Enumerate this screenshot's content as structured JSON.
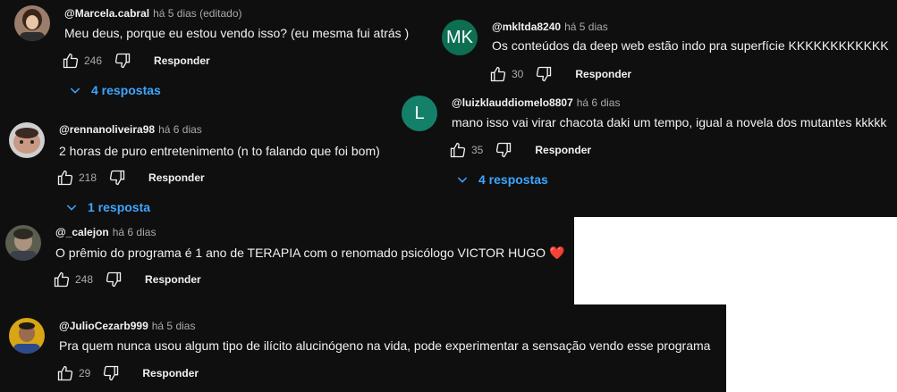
{
  "comments": [
    {
      "author": "@Marcela.cabral",
      "time": "há 5 dias (editado)",
      "text": "Meu deus, porque eu estou vendo isso? (eu mesma fui atrás )",
      "likes": "246",
      "reply_label": "Responder",
      "replies": "4 respostas"
    },
    {
      "author": "@mkltda8240",
      "time": "há 5 dias",
      "avatar_letter": "MK",
      "avatar_color": "#0d6e52",
      "text": "Os conteúdos da deep web estão indo pra superfície KKKKKKKKKKKK",
      "likes": "30",
      "reply_label": "Responder"
    },
    {
      "author": "@luizklauddiomelo8807",
      "time": "há 6 dias",
      "avatar_letter": "L",
      "avatar_color": "#15806a",
      "text": "mano isso vai virar chacota daki um tempo, igual a novela dos mutantes kkkkk",
      "likes": "35",
      "reply_label": "Responder",
      "replies": "4 respostas"
    },
    {
      "author": "@rennanoliveira98",
      "time": "há 6 dias",
      "text": "2 horas de puro entretenimento (n to falando que foi bom)",
      "likes": "218",
      "reply_label": "Responder",
      "replies": "1 resposta"
    },
    {
      "author": "@_calejon",
      "time": "há 6 dias",
      "text": "O prêmio do programa é 1 ano de TERAPIA com o renomado psicólogo VICTOR HUGO",
      "emoji": "❤️",
      "likes": "248",
      "reply_label": "Responder"
    },
    {
      "author": "@JulioCezarb999",
      "time": "há 5 dias",
      "text": "Pra quem nunca usou algum tipo de ilícito alucinógeno na vida, pode experimentar a sensação vendo esse programa",
      "likes": "29",
      "reply_label": "Responder"
    }
  ]
}
